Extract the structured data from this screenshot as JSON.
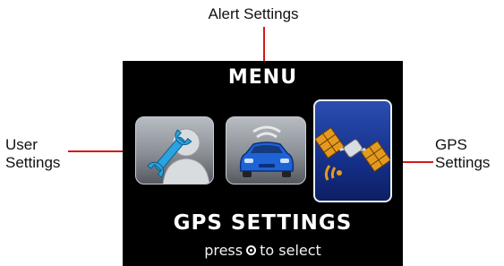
{
  "callouts": {
    "alert": "Alert Settings",
    "user_line1": "User",
    "user_line2": "Settings",
    "gps_line1": "GPS",
    "gps_line2": "Settings"
  },
  "screen": {
    "title": "MENU",
    "selected_label": "GPS SETTINGS",
    "hint_before": "press",
    "hint_after": "to select",
    "items": [
      {
        "name": "User Settings",
        "icon": "user-wrench-icon",
        "selected": false
      },
      {
        "name": "Alert Settings",
        "icon": "car-alert-icon",
        "selected": false
      },
      {
        "name": "GPS Settings",
        "icon": "satellite-icon",
        "selected": true
      }
    ],
    "select_button_icon": "select-button-icon"
  },
  "colors": {
    "callout_line": "#d11a1a",
    "screen_bg": "#000000",
    "selected_tile": "#1f3d9c",
    "unselected_tile": "#8a8f96"
  }
}
